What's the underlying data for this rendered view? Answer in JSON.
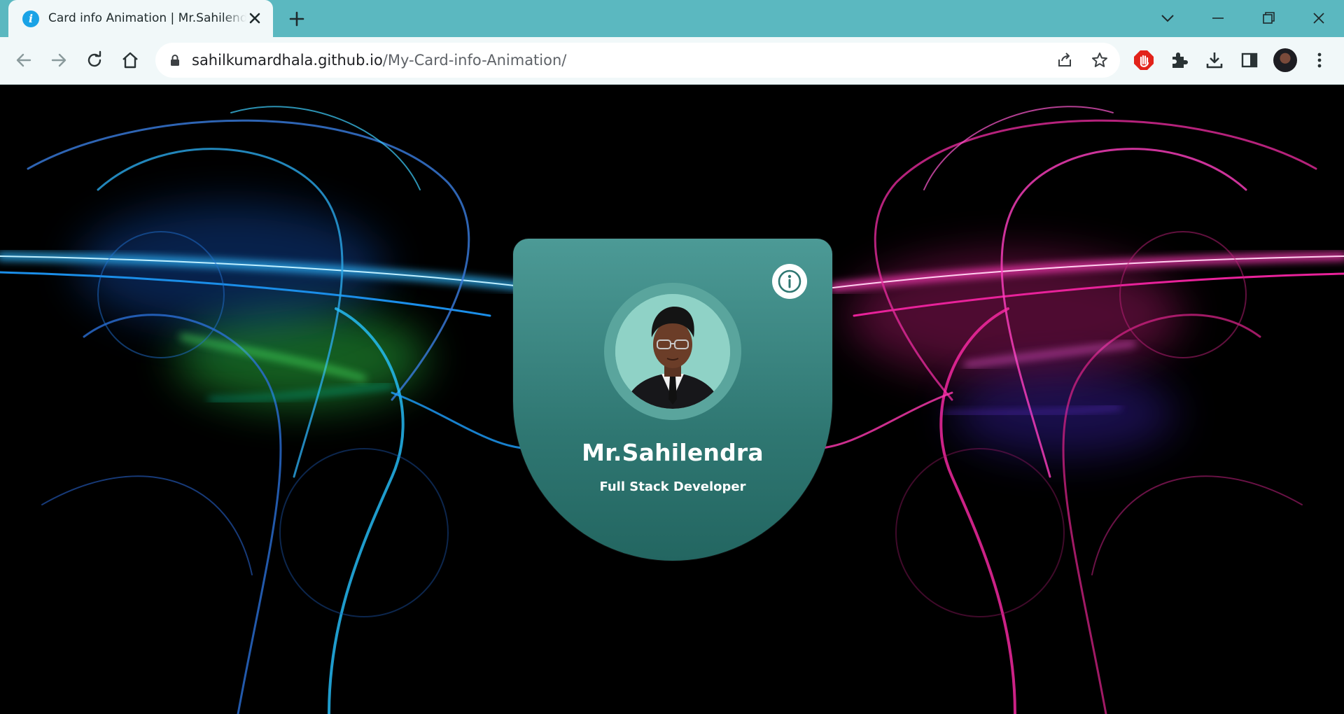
{
  "browser": {
    "tab": {
      "title": "Card info Animation | Mr.Sahilendra",
      "favicon_icon": "info-icon"
    },
    "address": {
      "domain": "sahilkumardhala.github.io",
      "path": "/My-Card-info-Animation/"
    },
    "extensions": [
      "adblock-hand-icon",
      "puzzle-extensions-icon",
      "download-icon",
      "side-panel-icon"
    ]
  },
  "card": {
    "name": "Mr.Sahilendra",
    "role": "Full Stack Developer",
    "info_icon": "info-icon",
    "colors": {
      "card_top": "#4c9a96",
      "card_bottom": "#236661",
      "text": "#ffffff"
    }
  },
  "theme": {
    "tabstrip": "#5bb8c0",
    "toolbar": "#f1f8f9",
    "background": "#000000"
  }
}
